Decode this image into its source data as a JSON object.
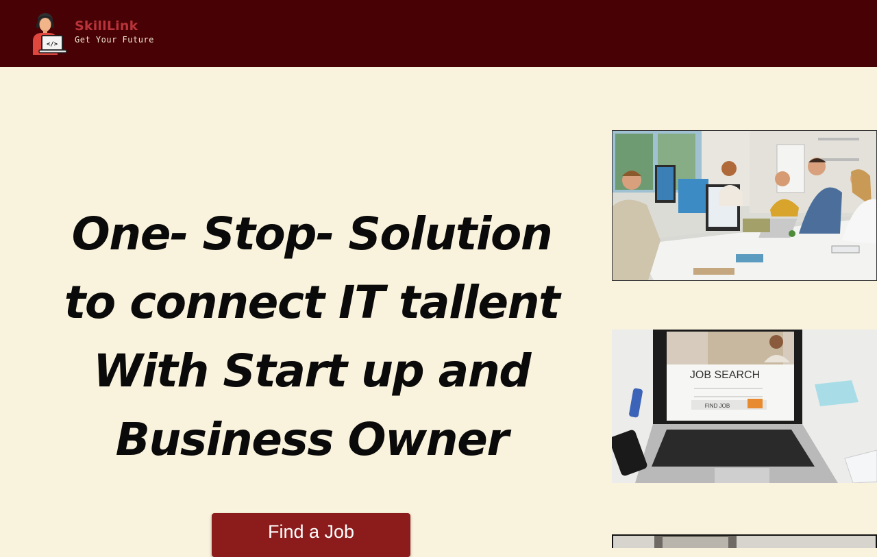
{
  "brand": {
    "name": "SkillLink",
    "tagline": "Get Your Future",
    "logo_icon": "developer-at-laptop-icon",
    "color": "#b8343a"
  },
  "header": {
    "background": "#480104"
  },
  "hero": {
    "title": "One- Stop- Solution to connect IT tallent With Start up and Business Owner",
    "cta_label": "Find a Job",
    "cta_color": "#8c1c1c",
    "background": "#f9f2dc"
  },
  "gallery": [
    {
      "name": "team-office-photo"
    },
    {
      "name": "job-search-laptop-photo",
      "screen_heading": "JOB SEARCH",
      "screen_button": "FIND JOB"
    },
    {
      "name": "third-photo"
    }
  ]
}
